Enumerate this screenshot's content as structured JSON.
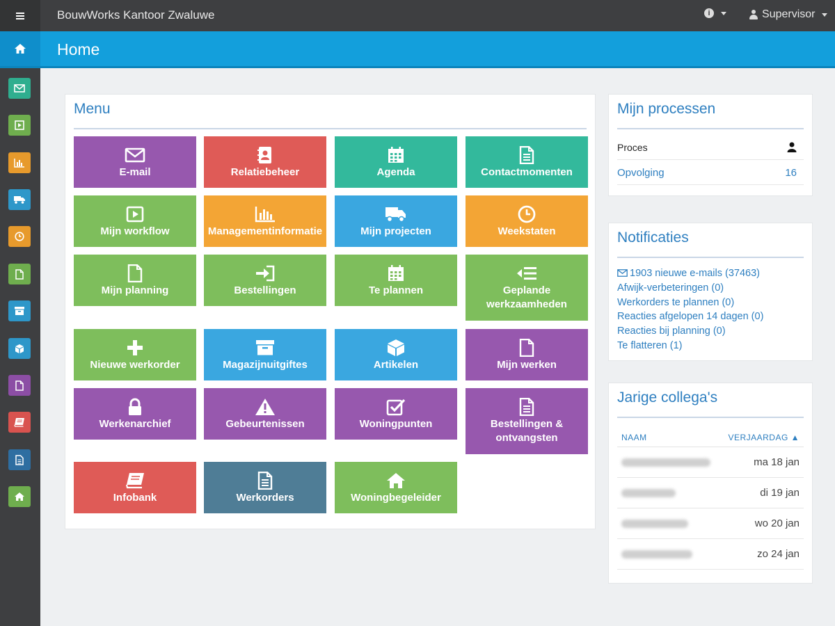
{
  "app": {
    "title": "BouwWorks Kantoor Zwaluwe"
  },
  "topbar": {
    "user_label": "Supervisor"
  },
  "header": {
    "title": "Home"
  },
  "sidebar": {
    "items": [
      {
        "icon": "envelope-icon",
        "color": "#2fae8f"
      },
      {
        "icon": "play-icon",
        "color": "#6fae4e"
      },
      {
        "icon": "bar-chart-icon",
        "color": "#e79a2c"
      },
      {
        "icon": "truck-icon",
        "color": "#2e97c9"
      },
      {
        "icon": "clock-icon",
        "color": "#e79a2c"
      },
      {
        "icon": "file-icon",
        "color": "#6fae4e"
      },
      {
        "icon": "archive-icon",
        "color": "#2e97c9"
      },
      {
        "icon": "cube-icon",
        "color": "#2e97c9"
      },
      {
        "icon": "file-icon",
        "color": "#8c4ea5"
      },
      {
        "icon": "book-icon",
        "color": "#d9534f"
      },
      {
        "icon": "file-text-icon",
        "color": "#2e6ea1"
      },
      {
        "icon": "home-icon",
        "color": "#6fae4e"
      }
    ]
  },
  "menu": {
    "title": "Menu",
    "tiles": [
      {
        "label": "E-mail",
        "icon": "envelope-icon",
        "color": "#9758ae"
      },
      {
        "label": "Relatiebeheer",
        "icon": "address-book-icon",
        "color": "#df5b57"
      },
      {
        "label": "Agenda",
        "icon": "calendar-icon",
        "color": "#33b99c"
      },
      {
        "label": "Contactmomenten",
        "icon": "file-text-icon",
        "color": "#33b99c"
      },
      {
        "label": "Mijn workflow",
        "icon": "play-icon",
        "color": "#7ebe5c"
      },
      {
        "label": "Managementinformatie",
        "icon": "bar-chart-icon",
        "color": "#f3a535"
      },
      {
        "label": "Mijn projecten",
        "icon": "truck-icon",
        "color": "#3aa7e0"
      },
      {
        "label": "Weekstaten",
        "icon": "clock-icon",
        "color": "#f3a535"
      },
      {
        "label": "Mijn planning",
        "icon": "file-icon",
        "color": "#7ebe5c"
      },
      {
        "label": "Bestellingen",
        "icon": "sign-in-icon",
        "color": "#7ebe5c"
      },
      {
        "label": "Te plannen",
        "icon": "calendar-icon",
        "color": "#7ebe5c"
      },
      {
        "label_line1": "Geplande",
        "label_line2": "werkzaamheden",
        "icon": "list-indent-icon",
        "color": "#7ebe5c"
      },
      {
        "label": "Nieuwe werkorder",
        "icon": "plus-icon",
        "color": "#7ebe5c"
      },
      {
        "label": "Magazijnuitgiftes",
        "icon": "archive-icon",
        "color": "#3aa7e0"
      },
      {
        "label": "Artikelen",
        "icon": "cube-icon",
        "color": "#3aa7e0"
      },
      {
        "label": "Mijn werken",
        "icon": "file-icon",
        "color": "#9758ae"
      },
      {
        "label": "Werkenarchief",
        "icon": "lock-icon",
        "color": "#9758ae"
      },
      {
        "label": "Gebeurtenissen",
        "icon": "warning-icon",
        "color": "#9758ae"
      },
      {
        "label": "Woningpunten",
        "icon": "check-square-icon",
        "color": "#9758ae"
      },
      {
        "label_line1": "Bestellingen &",
        "label_line2": "ontvangsten",
        "icon": "file-text-icon",
        "color": "#9758ae"
      },
      {
        "label": "Infobank",
        "icon": "book-icon",
        "color": "#df5b57"
      },
      {
        "label": "Werkorders",
        "icon": "file-text-icon",
        "color": "#4f7d96"
      },
      {
        "label": "Woningbegeleider",
        "icon": "home-icon",
        "color": "#7ebe5c"
      }
    ]
  },
  "processes": {
    "title": "Mijn processen",
    "header_label": "Proces",
    "rows": [
      {
        "label": "Opvolging",
        "count": "16"
      }
    ]
  },
  "notifications": {
    "title": "Notificaties",
    "items": [
      "1903 nieuwe e-mails (37463)",
      "Afwijk-verbeteringen (0)",
      "Werkorders te plannen (0)",
      "Reacties afgelopen 14 dagen (0)",
      "Reacties bij planning (0)",
      "Te flatteren (1)"
    ]
  },
  "birthdays": {
    "title": "Jarige collega's",
    "col_name": "NAAM",
    "col_date": "VERJAARDAG ▲",
    "rows": [
      {
        "date": "ma 18 jan"
      },
      {
        "date": "di 19 jan"
      },
      {
        "date": "wo 20 jan"
      },
      {
        "date": "zo 24 jan"
      }
    ]
  }
}
